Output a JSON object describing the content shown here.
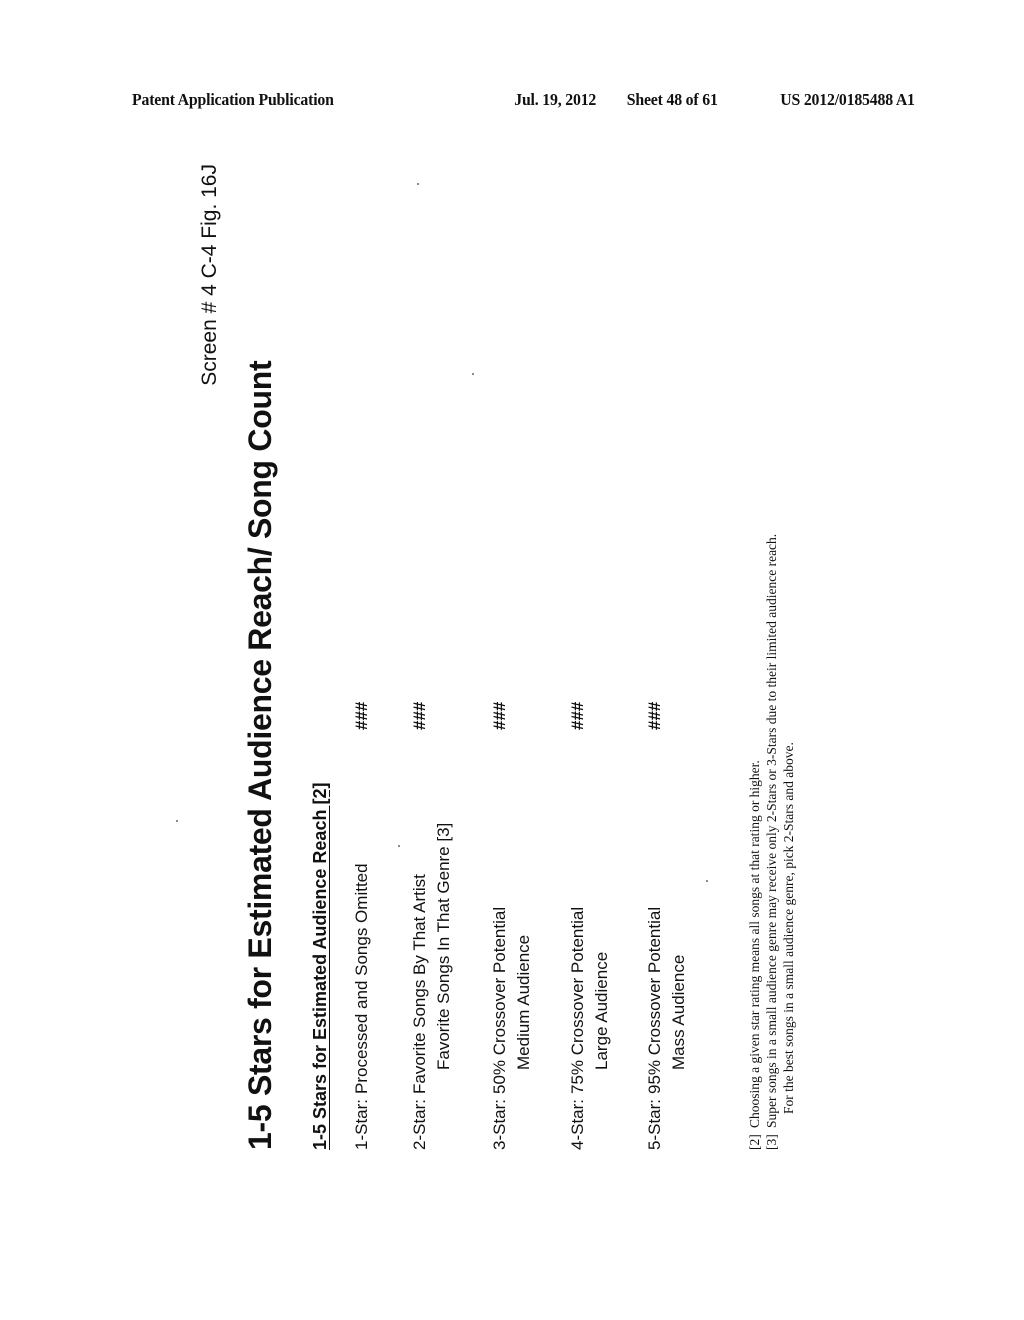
{
  "header": {
    "publication": "Patent Application Publication",
    "date": "Jul. 19, 2012",
    "sheet": "Sheet 48 of 61",
    "number": "US 2012/0185488 A1"
  },
  "figure": {
    "label": "Screen # 4 C-4  Fig. 16J",
    "title": "1-5 Stars for Estimated Audience Reach/ Song Count",
    "subheading": "1-5 Stars for Estimated Audience Reach [2]",
    "rows": [
      {
        "star": "1-Star:",
        "line1": "Processed and Songs Omitted",
        "line2": "",
        "count": "###"
      },
      {
        "star": "2-Star:",
        "line1": "Favorite Songs By That Artist",
        "line2": "Favorite Songs In That Genre [3]",
        "count": "###"
      },
      {
        "star": "3-Star:",
        "line1": "50% Crossover Potential",
        "line2": "Medium Audience",
        "count": "###"
      },
      {
        "star": "4-Star:",
        "line1": "75% Crossover Potential",
        "line2": "Large Audience",
        "count": "###"
      },
      {
        "star": "5-Star:",
        "line1": "95% Crossover Potential",
        "line2": "Mass Audience",
        "count": "###"
      }
    ],
    "footnotes": [
      {
        "ref": "[2]",
        "text": "Choosing a given star rating means all songs at that rating or higher."
      },
      {
        "ref": "[3]",
        "text": "Super songs in a small audience genre may receive only 2-Stars or 3-Stars due to their limited audience reach."
      },
      {
        "ref": "",
        "text": "For the best songs in a small audience genre,  pick 2-Stars and above."
      }
    ]
  }
}
